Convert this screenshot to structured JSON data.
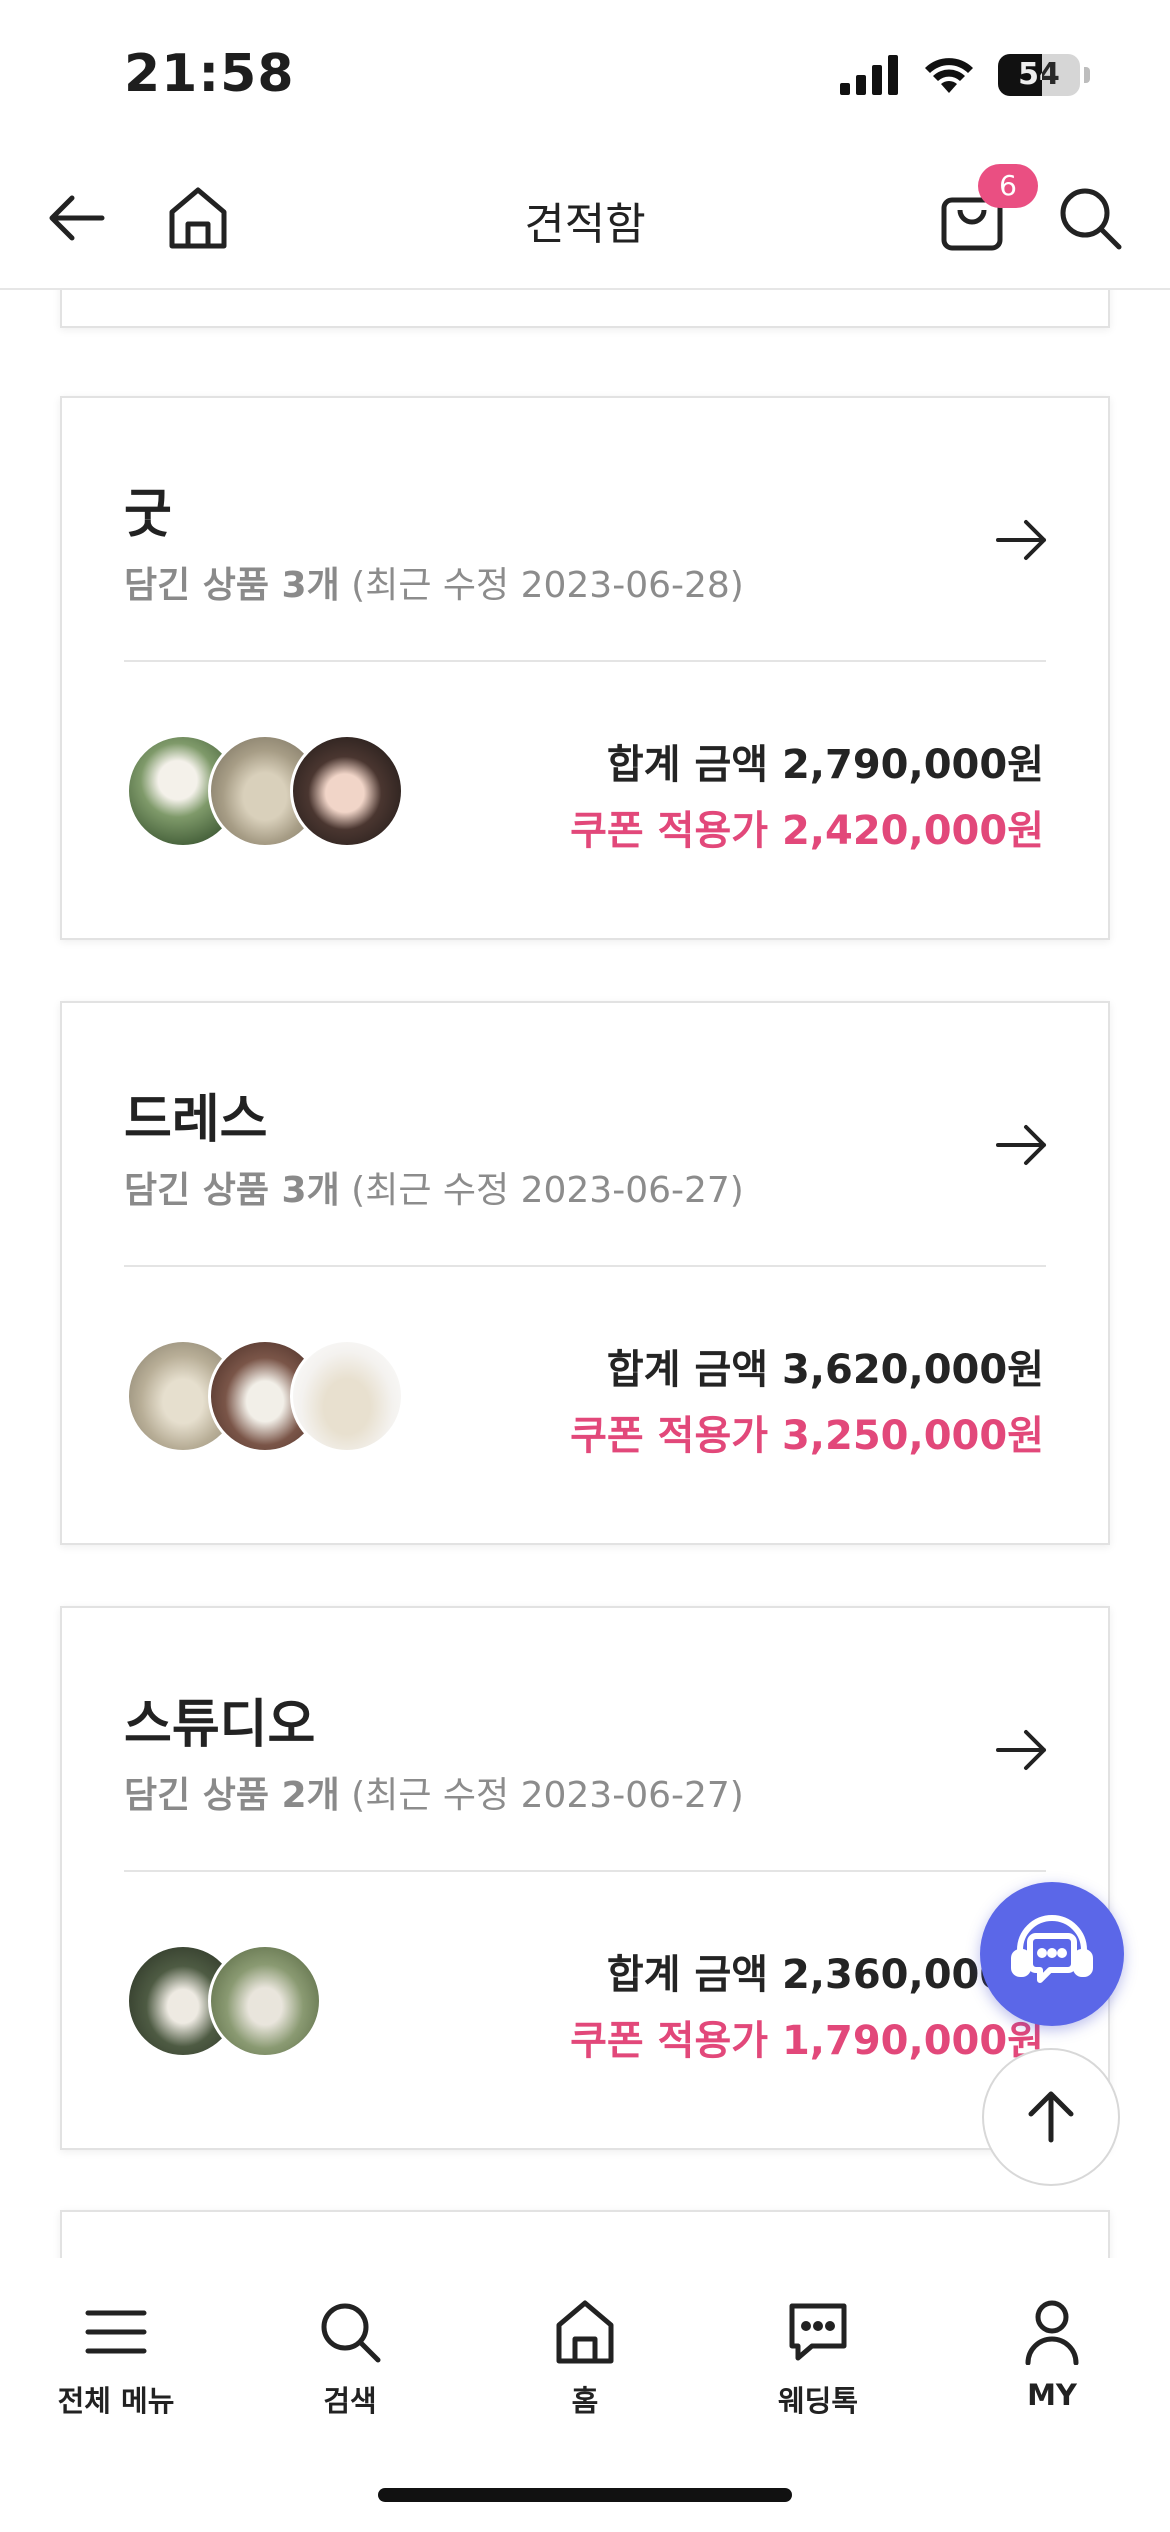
{
  "status": {
    "time": "21:58",
    "battery": "54",
    "battery_level": 0.54
  },
  "header": {
    "title": "견적함",
    "cart_count": "6"
  },
  "cards": [
    {
      "title": "굿",
      "count_label": "담긴 상품 3개",
      "modified": "(최근 수정 2023-06-28)",
      "total": "합계 금액 2,790,000원",
      "coupon": "쿠폰 적용가 2,420,000원"
    },
    {
      "title": "드레스",
      "count_label": "담긴 상품 3개",
      "modified": "(최근 수정 2023-06-27)",
      "total": "합계 금액 3,620,000원",
      "coupon": "쿠폰 적용가 3,250,000원"
    },
    {
      "title": "스튜디오",
      "count_label": "담긴 상품 2개",
      "modified": "(최근 수정 2023-06-27)",
      "total": "합계 금액 2,360,000원",
      "coupon": "쿠폰 적용가 1,790,000원"
    }
  ],
  "tabs": [
    {
      "label": "전체 메뉴",
      "icon": "menu-icon"
    },
    {
      "label": "검색",
      "icon": "search-icon"
    },
    {
      "label": "홈",
      "icon": "home-icon"
    },
    {
      "label": "웨딩톡",
      "icon": "chat-icon"
    },
    {
      "label": "MY",
      "icon": "user-icon"
    }
  ],
  "colors": {
    "accent": "#e2487a",
    "badge": "#ea4f82",
    "chat_fab": "#5b67e8"
  }
}
